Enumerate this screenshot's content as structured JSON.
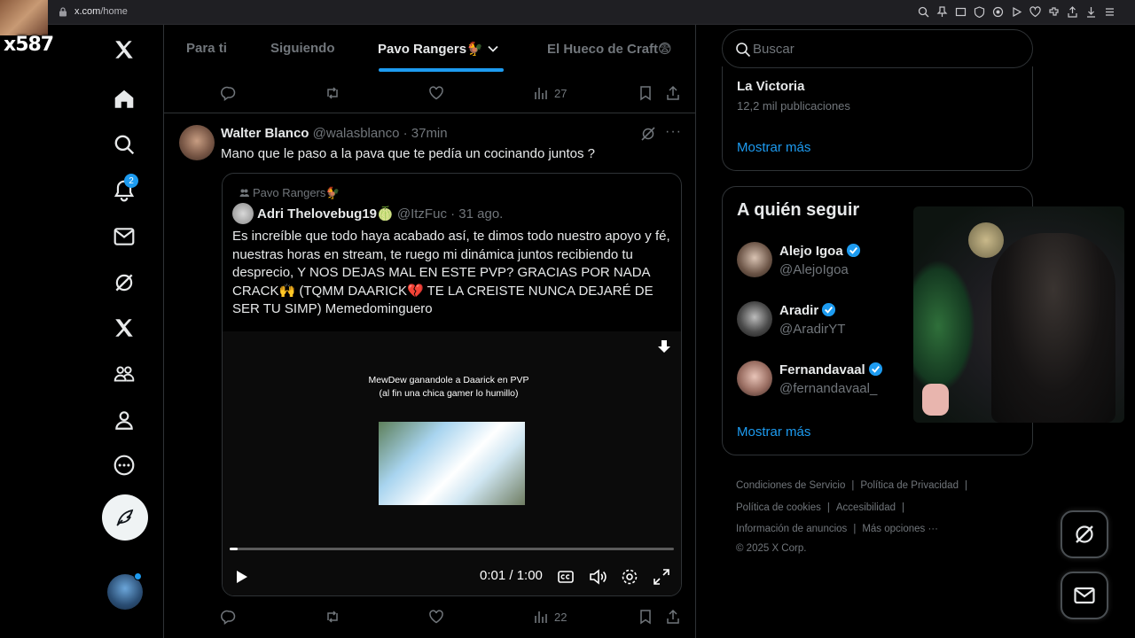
{
  "browser": {
    "url_host": "x.com",
    "url_path": "/home"
  },
  "overlay": {
    "counter": "x587"
  },
  "sidebar": {
    "notification_count": "2"
  },
  "tabs": [
    {
      "label": "Para ti"
    },
    {
      "label": "Siguiendo"
    },
    {
      "label": "Pavo Rangers🐓",
      "active": true
    },
    {
      "label": "El Hueco de Craft😨"
    }
  ],
  "top_tweet_actions": {
    "views": "27"
  },
  "tweet": {
    "name": "Walter Blanco",
    "handle": "@walasblanco",
    "time": "· 37min",
    "text": "Mano que le paso a la pava que te pedía un cocinando juntos ?",
    "quote": {
      "community": "Pavo Rangers🐓",
      "name": "Adri Thelovebug19🍈",
      "handle": "@ItzFuc",
      "time": "· 31 ago.",
      "text": "Es increíble que todo haya acabado así, te dimos todo nuestro apoyo y fé, nuestras horas en stream, te ruego mi dinámica juntos recibiendo tu desprecio, Y NOS DEJAS MAL EN ESTE PVP? GRACIAS POR NADA CRACK🙌 (TQMM DAARICK💔 TE LA CREISTE NUNCA DEJARÉ DE SER TU SIMP) Memedominguero",
      "video": {
        "caption": "MewDew ganandole a Daarick en PVP (al fin una chica gamer lo humillo)",
        "time": "0:01 / 1:00",
        "progress": 0.017
      }
    },
    "views": "22"
  },
  "right": {
    "search_placeholder": "Buscar",
    "trend": {
      "title": "La Victoria",
      "count": "12,2 mil publicaciones",
      "show_more": "Mostrar más"
    },
    "follow": {
      "title": "A quién seguir",
      "users": [
        {
          "name": "Alejo Igoa",
          "handle": "@AlejoIgoa"
        },
        {
          "name": "Aradir",
          "handle": "@AradirYT"
        },
        {
          "name": "Fernandavaal",
          "handle": "@fernandavaal_"
        }
      ],
      "show_more": "Mostrar más"
    },
    "footer": {
      "terms": "Condiciones de Servicio",
      "privacy": "Política de Privacidad",
      "cookies": "Política de cookies",
      "accessibility": "Accesibilidad",
      "ads": "Información de anuncios",
      "more": "Más opciones ···",
      "copyright": "© 2025 X Corp."
    }
  },
  "colors": {
    "accent": "#1d9bf0",
    "background": "#000000",
    "muted": "#71767b",
    "border": "#2f3336"
  },
  "icons": [
    "home-icon",
    "explore-icon",
    "bell-icon",
    "mail-icon",
    "grok-icon",
    "x-logo-icon",
    "communities-icon",
    "profile-icon",
    "more-icon",
    "compose-icon"
  ]
}
